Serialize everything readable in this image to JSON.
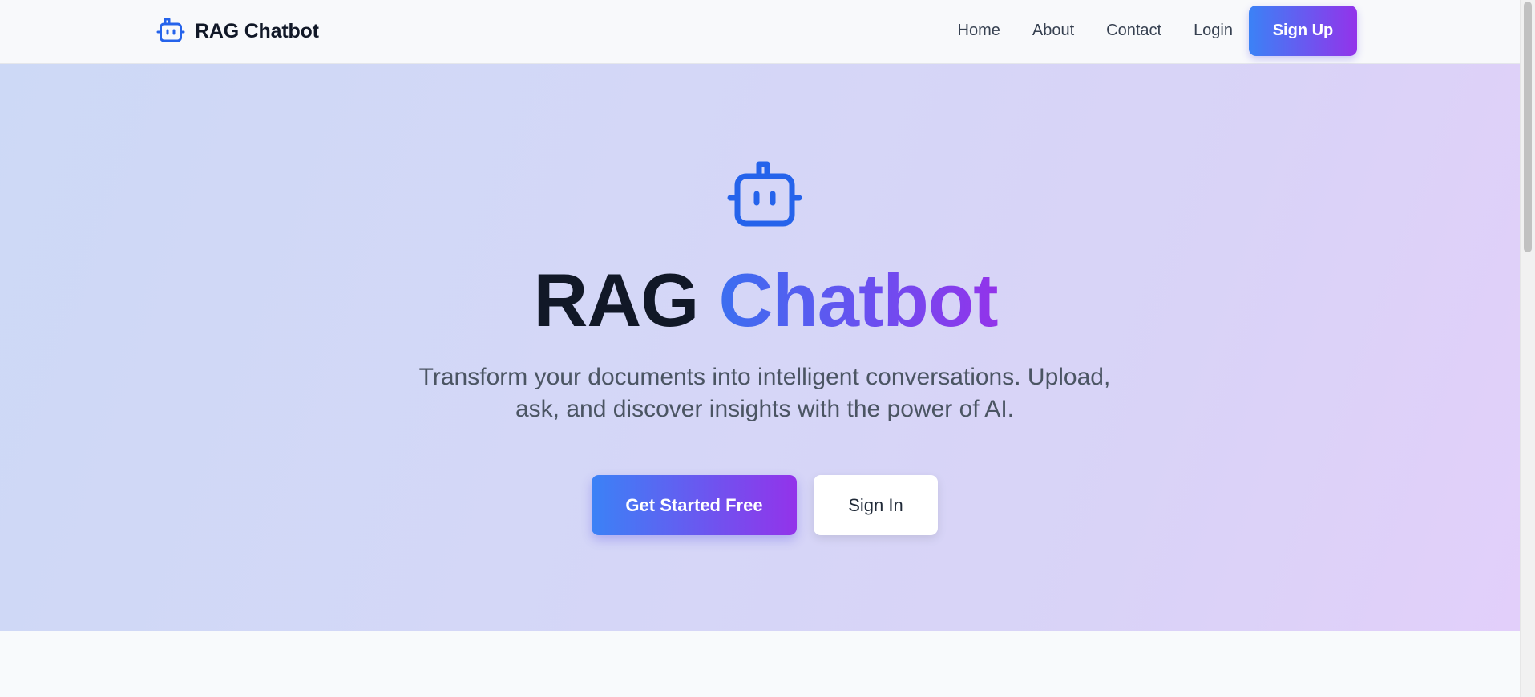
{
  "brand": {
    "name": "RAG Chatbot",
    "icon": "robot-icon"
  },
  "nav": {
    "links": [
      "Home",
      "About",
      "Contact",
      "Login"
    ],
    "signup_label": "Sign Up"
  },
  "hero": {
    "icon": "robot-icon",
    "title_plain": "RAG",
    "title_gradient": "Chatbot",
    "subtitle_line1": "Transform your documents into intelligent conversations. Upload,",
    "subtitle_line2": "ask, and discover insights with the power of AI.",
    "primary_button": "Get Started Free",
    "secondary_button": "Sign In"
  },
  "colors": {
    "brand_blue": "#2563eb",
    "gradient_start": "#3b82f6",
    "gradient_end": "#9333ea",
    "heading": "#111827",
    "body_text": "#4b5563"
  }
}
